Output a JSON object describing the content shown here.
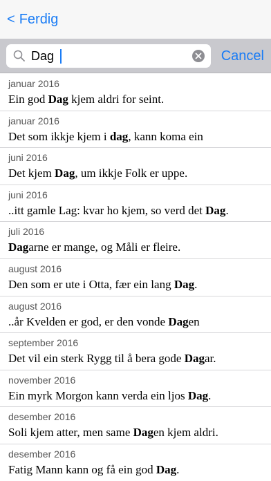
{
  "navbar": {
    "back_label": "Ferdig",
    "back_icon": "chevron-left-icon"
  },
  "search": {
    "value": "Dag",
    "cancel_label": "Cancel"
  },
  "results": [
    {
      "date": "januar 2016",
      "before": "Ein god ",
      "match": "Dag",
      "after": " kjem aldri for seint."
    },
    {
      "date": "januar 2016",
      "before": "Det som ikkje kjem i ",
      "match": "dag",
      "after": ", kann koma ein"
    },
    {
      "date": "juni 2016",
      "before": "Det kjem ",
      "match": "Dag",
      "after": ", um ikkje Folk er uppe."
    },
    {
      "date": "juni 2016",
      "before": "..itt gamle Lag: kvar ho kjem, so verd det ",
      "match": "Dag",
      "after": "."
    },
    {
      "date": "juli 2016",
      "before": "",
      "match": "Dag",
      "after": "arne er mange, og Måli er fleire."
    },
    {
      "date": "august 2016",
      "before": "Den som er ute i Otta, fær ein lang ",
      "match": "Dag",
      "after": "."
    },
    {
      "date": "august 2016",
      "before": "..år Kvelden er god, er den vonde ",
      "match": "Dag",
      "after": "en"
    },
    {
      "date": "september 2016",
      "before": "Det vil ein sterk Rygg til å bera gode ",
      "match": "Dag",
      "after": "ar."
    },
    {
      "date": "november 2016",
      "before": "Ein myrk Morgon kann verda ein ljos ",
      "match": "Dag",
      "after": "."
    },
    {
      "date": "desember 2016",
      "before": "Soli kjem atter, men same ",
      "match": "Dag",
      "after": "en kjem aldri."
    },
    {
      "date": "desember 2016",
      "before": "Fatig Mann kann og få ein god ",
      "match": "Dag",
      "after": "."
    }
  ],
  "colors": {
    "accent": "#1a7cf5",
    "searchbar_bg": "#c9c9ce",
    "navbar_bg": "#f7f7f7"
  }
}
